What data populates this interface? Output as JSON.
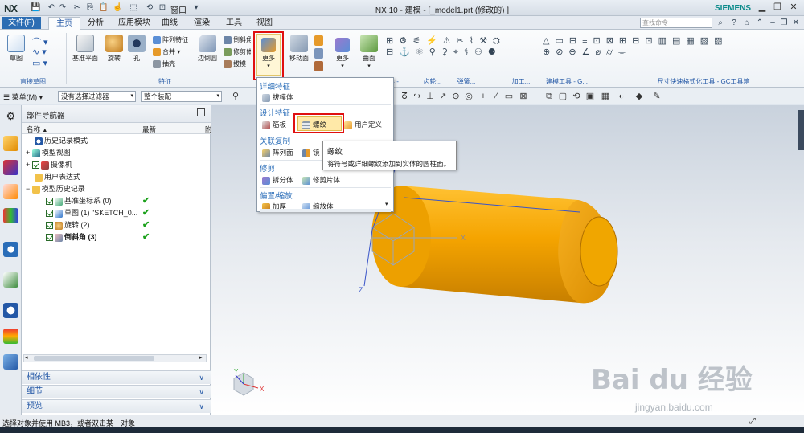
{
  "app": {
    "logo": "NX",
    "title": "NX 10 - 建模 - [_model1.prt  (修改的) ]",
    "brand": "SIEMENS",
    "window_menu": "窗口"
  },
  "menubar": {
    "file": "文件(F)",
    "tabs": [
      "主页",
      "分析",
      "应用模块",
      "曲线",
      "渲染",
      "工具",
      "视图"
    ],
    "search_placeholder": "查找命令"
  },
  "ribbon": {
    "sketch": "草图",
    "datum_plane": "基准平面",
    "revolve": "旋转",
    "hole": "孔",
    "pattern_feature": "阵列特征",
    "unite": "合并",
    "shell": "抽壳",
    "edge_blend": "边倒圆",
    "chamfer": "倒斜角",
    "trim_body": "修剪体",
    "draft": "拔模",
    "more": "更多",
    "move_face": "移动面",
    "more2": "更多",
    "surface": "曲面",
    "groups": {
      "direct_sketch": "直接草图",
      "feature": "特征",
      "ribbon_tools": [
        "化工具 - G...",
        "齿轮...",
        "弹簧...",
        "加工...",
        "建模工具 - G...",
        "尺寸快速格式化工具 - GC工具箱"
      ]
    }
  },
  "selbar": {
    "menu": "菜单(M)",
    "filter": "没有选择过滤器",
    "assembly": "整个装配"
  },
  "navigator": {
    "title": "部件导航器",
    "col_name": "名称",
    "col_latest": "最新",
    "col_extra": "附",
    "rows": [
      {
        "label": "历史记录模式"
      },
      {
        "label": "模型视图"
      },
      {
        "label": "摄像机"
      },
      {
        "label": "用户表达式"
      },
      {
        "label": "模型历史记录"
      },
      {
        "label": "基准坐标系 (0)",
        "latest": "✔"
      },
      {
        "label": "草图 (1) \"SKETCH_0...",
        "latest": "✔"
      },
      {
        "label": "旋转 (2)",
        "latest": "✔"
      },
      {
        "label": "倒斜角 (3)",
        "latest": "✔"
      }
    ],
    "panels": [
      "相依性",
      "细节",
      "预览"
    ]
  },
  "dropdown": {
    "detail_feature": "详细特征",
    "draft_body": "拔模体",
    "design_feature": "设计特征",
    "rib": "筋板",
    "thread": "螺纹",
    "user_defined": "用户定义",
    "associative_copy": "关联复制",
    "pattern_geometry": "阵列面",
    "mirror": "镜",
    "trim": "修剪",
    "split_body": "拆分体",
    "trim_sheet": "修剪片体",
    "offset_scale": "偏置/缩放",
    "thicken": "加厚",
    "scale_body": "缩放体"
  },
  "tooltip": {
    "title": "螺纹",
    "desc": "将符号或详细螺纹添加到实体的圆柱面。"
  },
  "status": {
    "text": "选择对象并使用 MB3，或者双击某一对象"
  },
  "axes": {
    "x": "X",
    "y": "Y",
    "z": "Z"
  },
  "watermark": {
    "brand": "Bai du 经验",
    "url": "jingyan.baidu.com"
  },
  "colors": {
    "accent": "#2c6db3",
    "part": "#f5a400",
    "highlight": "#e01010"
  }
}
